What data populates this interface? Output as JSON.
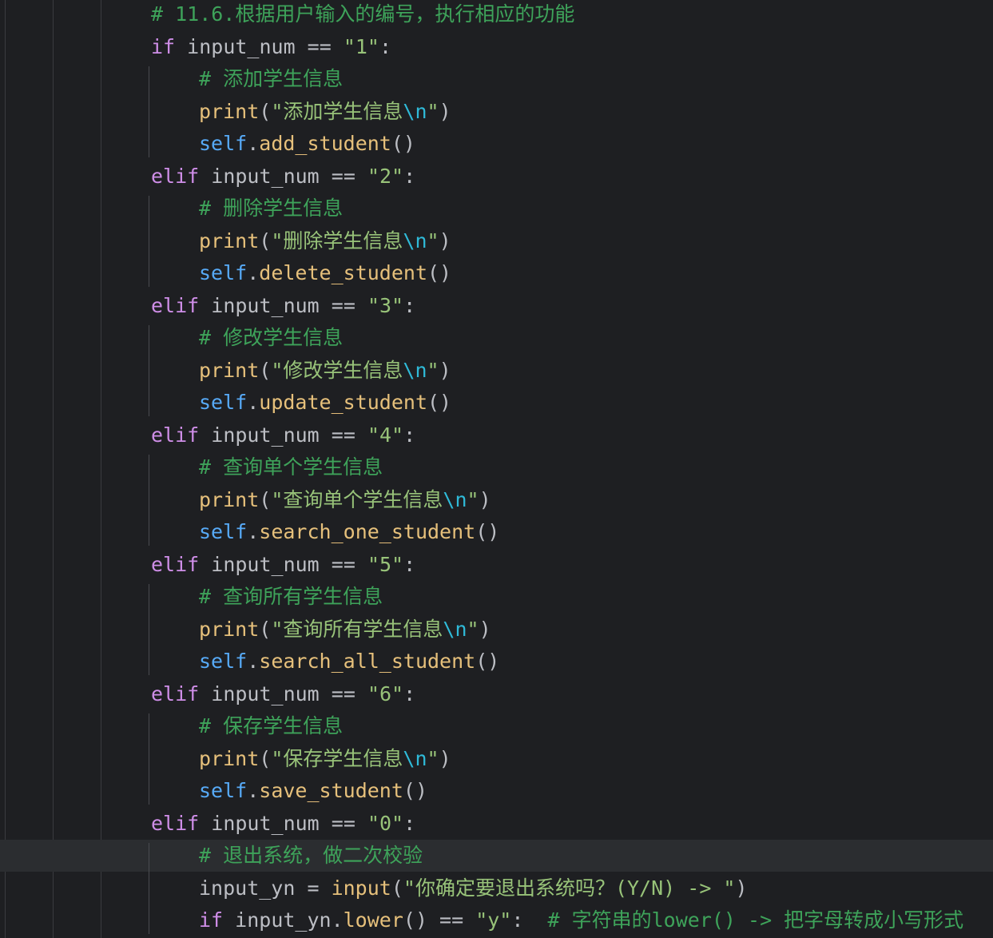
{
  "editor": {
    "current_line_index": 26,
    "lines": [
      {
        "indent": 1,
        "tokens": [
          {
            "t": "# 11.6.根据用户输入的编号，执行相应的功能",
            "c": "cmt"
          }
        ]
      },
      {
        "indent": 1,
        "tokens": [
          {
            "t": "if",
            "c": "kw"
          },
          {
            "t": " input_num == ",
            "c": "id"
          },
          {
            "t": "\"1\"",
            "c": "str"
          },
          {
            "t": ":",
            "c": "pn"
          }
        ]
      },
      {
        "indent": 2,
        "tokens": [
          {
            "t": "# 添加学生信息",
            "c": "cmt"
          }
        ]
      },
      {
        "indent": 2,
        "tokens": [
          {
            "t": "print",
            "c": "fn"
          },
          {
            "t": "(",
            "c": "pn"
          },
          {
            "t": "\"添加学生信息",
            "c": "str"
          },
          {
            "t": "\\n",
            "c": "esc"
          },
          {
            "t": "\"",
            "c": "str"
          },
          {
            "t": ")",
            "c": "pn"
          }
        ]
      },
      {
        "indent": 2,
        "tokens": [
          {
            "t": "self",
            "c": "self"
          },
          {
            "t": ".",
            "c": "pn"
          },
          {
            "t": "add_student",
            "c": "fn"
          },
          {
            "t": "()",
            "c": "pn"
          }
        ]
      },
      {
        "indent": 1,
        "tokens": [
          {
            "t": "elif",
            "c": "kw"
          },
          {
            "t": " input_num == ",
            "c": "id"
          },
          {
            "t": "\"2\"",
            "c": "str"
          },
          {
            "t": ":",
            "c": "pn"
          }
        ]
      },
      {
        "indent": 2,
        "tokens": [
          {
            "t": "# 删除学生信息",
            "c": "cmt"
          }
        ]
      },
      {
        "indent": 2,
        "tokens": [
          {
            "t": "print",
            "c": "fn"
          },
          {
            "t": "(",
            "c": "pn"
          },
          {
            "t": "\"删除学生信息",
            "c": "str"
          },
          {
            "t": "\\n",
            "c": "esc"
          },
          {
            "t": "\"",
            "c": "str"
          },
          {
            "t": ")",
            "c": "pn"
          }
        ]
      },
      {
        "indent": 2,
        "tokens": [
          {
            "t": "self",
            "c": "self"
          },
          {
            "t": ".",
            "c": "pn"
          },
          {
            "t": "delete_student",
            "c": "fn"
          },
          {
            "t": "()",
            "c": "pn"
          }
        ]
      },
      {
        "indent": 1,
        "tokens": [
          {
            "t": "elif",
            "c": "kw"
          },
          {
            "t": " input_num == ",
            "c": "id"
          },
          {
            "t": "\"3\"",
            "c": "str"
          },
          {
            "t": ":",
            "c": "pn"
          }
        ]
      },
      {
        "indent": 2,
        "tokens": [
          {
            "t": "# 修改学生信息",
            "c": "cmt"
          }
        ]
      },
      {
        "indent": 2,
        "tokens": [
          {
            "t": "print",
            "c": "fn"
          },
          {
            "t": "(",
            "c": "pn"
          },
          {
            "t": "\"修改学生信息",
            "c": "str"
          },
          {
            "t": "\\n",
            "c": "esc"
          },
          {
            "t": "\"",
            "c": "str"
          },
          {
            "t": ")",
            "c": "pn"
          }
        ]
      },
      {
        "indent": 2,
        "tokens": [
          {
            "t": "self",
            "c": "self"
          },
          {
            "t": ".",
            "c": "pn"
          },
          {
            "t": "update_student",
            "c": "fn"
          },
          {
            "t": "()",
            "c": "pn"
          }
        ]
      },
      {
        "indent": 1,
        "tokens": [
          {
            "t": "elif",
            "c": "kw"
          },
          {
            "t": " input_num == ",
            "c": "id"
          },
          {
            "t": "\"4\"",
            "c": "str"
          },
          {
            "t": ":",
            "c": "pn"
          }
        ]
      },
      {
        "indent": 2,
        "tokens": [
          {
            "t": "# 查询单个学生信息",
            "c": "cmt"
          }
        ]
      },
      {
        "indent": 2,
        "tokens": [
          {
            "t": "print",
            "c": "fn"
          },
          {
            "t": "(",
            "c": "pn"
          },
          {
            "t": "\"查询单个学生信息",
            "c": "str"
          },
          {
            "t": "\\n",
            "c": "esc"
          },
          {
            "t": "\"",
            "c": "str"
          },
          {
            "t": ")",
            "c": "pn"
          }
        ]
      },
      {
        "indent": 2,
        "tokens": [
          {
            "t": "self",
            "c": "self"
          },
          {
            "t": ".",
            "c": "pn"
          },
          {
            "t": "search_one_student",
            "c": "fn"
          },
          {
            "t": "()",
            "c": "pn"
          }
        ]
      },
      {
        "indent": 1,
        "tokens": [
          {
            "t": "elif",
            "c": "kw"
          },
          {
            "t": " input_num == ",
            "c": "id"
          },
          {
            "t": "\"5\"",
            "c": "str"
          },
          {
            "t": ":",
            "c": "pn"
          }
        ]
      },
      {
        "indent": 2,
        "tokens": [
          {
            "t": "# 查询所有学生信息",
            "c": "cmt"
          }
        ]
      },
      {
        "indent": 2,
        "tokens": [
          {
            "t": "print",
            "c": "fn"
          },
          {
            "t": "(",
            "c": "pn"
          },
          {
            "t": "\"查询所有学生信息",
            "c": "str"
          },
          {
            "t": "\\n",
            "c": "esc"
          },
          {
            "t": "\"",
            "c": "str"
          },
          {
            "t": ")",
            "c": "pn"
          }
        ]
      },
      {
        "indent": 2,
        "tokens": [
          {
            "t": "self",
            "c": "self"
          },
          {
            "t": ".",
            "c": "pn"
          },
          {
            "t": "search_all_student",
            "c": "fn"
          },
          {
            "t": "()",
            "c": "pn"
          }
        ]
      },
      {
        "indent": 1,
        "tokens": [
          {
            "t": "elif",
            "c": "kw"
          },
          {
            "t": " input_num == ",
            "c": "id"
          },
          {
            "t": "\"6\"",
            "c": "str"
          },
          {
            "t": ":",
            "c": "pn"
          }
        ]
      },
      {
        "indent": 2,
        "tokens": [
          {
            "t": "# 保存学生信息",
            "c": "cmt"
          }
        ]
      },
      {
        "indent": 2,
        "tokens": [
          {
            "t": "print",
            "c": "fn"
          },
          {
            "t": "(",
            "c": "pn"
          },
          {
            "t": "\"保存学生信息",
            "c": "str"
          },
          {
            "t": "\\n",
            "c": "esc"
          },
          {
            "t": "\"",
            "c": "str"
          },
          {
            "t": ")",
            "c": "pn"
          }
        ]
      },
      {
        "indent": 2,
        "tokens": [
          {
            "t": "self",
            "c": "self"
          },
          {
            "t": ".",
            "c": "pn"
          },
          {
            "t": "save_student",
            "c": "fn"
          },
          {
            "t": "()",
            "c": "pn"
          }
        ]
      },
      {
        "indent": 1,
        "tokens": [
          {
            "t": "elif",
            "c": "kw"
          },
          {
            "t": " input_num == ",
            "c": "id"
          },
          {
            "t": "\"0\"",
            "c": "str"
          },
          {
            "t": ":",
            "c": "pn"
          }
        ]
      },
      {
        "indent": 2,
        "tokens": [
          {
            "t": "# 退出系统，做二次校验",
            "c": "cmt"
          }
        ]
      },
      {
        "indent": 2,
        "tokens": [
          {
            "t": "input_yn = ",
            "c": "id"
          },
          {
            "t": "input",
            "c": "fn"
          },
          {
            "t": "(",
            "c": "pn"
          },
          {
            "t": "\"你确定要退出系统吗？(Y/N) -> \"",
            "c": "str"
          },
          {
            "t": ")",
            "c": "pn"
          }
        ]
      },
      {
        "indent": 2,
        "tokens": [
          {
            "t": "if",
            "c": "kw"
          },
          {
            "t": " input_yn.",
            "c": "id"
          },
          {
            "t": "lower",
            "c": "fn"
          },
          {
            "t": "() == ",
            "c": "pn"
          },
          {
            "t": "\"y\"",
            "c": "str"
          },
          {
            "t": ":  ",
            "c": "pn"
          },
          {
            "t": "# 字符串的lower() -> 把字母转成小写形式",
            "c": "cmt"
          }
        ]
      }
    ]
  }
}
